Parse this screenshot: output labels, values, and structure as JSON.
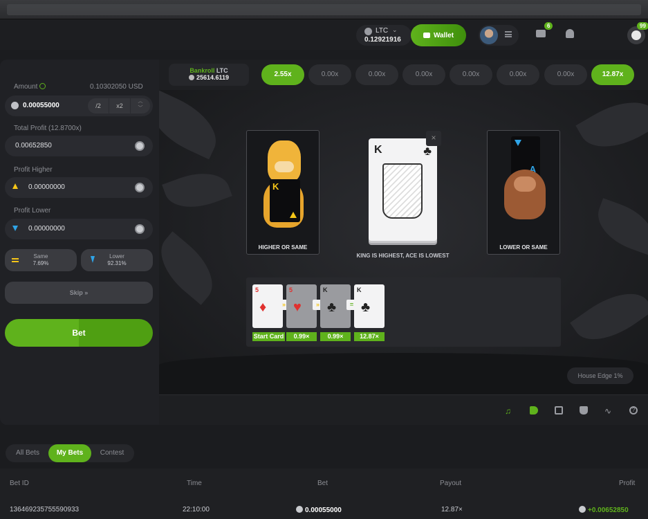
{
  "header": {
    "currency_code": "LTC",
    "currency_balance": "0.12921916",
    "wallet_label": "Wallet",
    "mail_count": "6",
    "profile_badge": "99"
  },
  "left_panel": {
    "amount_label": "Amount",
    "amount_usd": "0.10302050 USD",
    "amount_value": "0.00055000",
    "half_label": "/2",
    "double_label": "x2",
    "total_profit_label": "Total Profit (12.8700x)",
    "total_profit_value": "0.00652850",
    "profit_higher_label": "Profit Higher",
    "profit_higher_value": "0.00000000",
    "profit_lower_label": "Profit Lower",
    "profit_lower_value": "0.00000000",
    "same_label": "Same",
    "same_pct": "7.69%",
    "lower_label": "Lower",
    "lower_pct": "92.31%",
    "skip_label": "Skip",
    "bet_label": "Bet"
  },
  "multiplier_bar": {
    "bankroll_label": "Bankroll",
    "bankroll_currency": "LTC",
    "bankroll_value": "25614.6119",
    "chips": [
      "2.55x",
      "0.00x",
      "0.00x",
      "0.00x",
      "0.00x",
      "0.00x",
      "0.00x",
      "12.87x"
    ],
    "active_chips": [
      0,
      7
    ]
  },
  "game": {
    "higher_label": "HIGHER OR SAME",
    "higher_card_rank": "K",
    "lower_label": "LOWER OR SAME",
    "lower_card_rank": "A",
    "current_card_rank": "K",
    "current_card_suit": "♣",
    "close_symbol": "×",
    "hint": "KING IS HIGHEST, ACE IS LOWEST",
    "history": [
      {
        "rank": "5",
        "suit": "♦",
        "color": "#e0302e",
        "label": "Start Card"
      },
      {
        "rank": "5",
        "suit": "♥",
        "color": "#e0302e",
        "label": "0.99×"
      },
      {
        "rank": "K",
        "suit": "♣",
        "color": "#222222",
        "label": "0.99×"
      },
      {
        "rank": "K",
        "suit": "♣",
        "color": "#222222",
        "label": "12.87×"
      }
    ],
    "connectors": [
      "»",
      "»",
      "="
    ],
    "house_edge": "House Edge 1%"
  },
  "bets": {
    "tabs": [
      "All Bets",
      "My Bets",
      "Contest"
    ],
    "active_tab": 1,
    "columns": [
      "Bet ID",
      "Time",
      "Bet",
      "Payout",
      "Profit"
    ],
    "rows": [
      {
        "bet_id": "136469235755590933",
        "time": "22:10:00",
        "bet": "0.00055000",
        "payout": "12.87×",
        "profit": "+0.00652850"
      }
    ]
  },
  "colors": {
    "accent": "#5fb21c",
    "higher": "#f5c518",
    "lower": "#2fa4e7"
  }
}
